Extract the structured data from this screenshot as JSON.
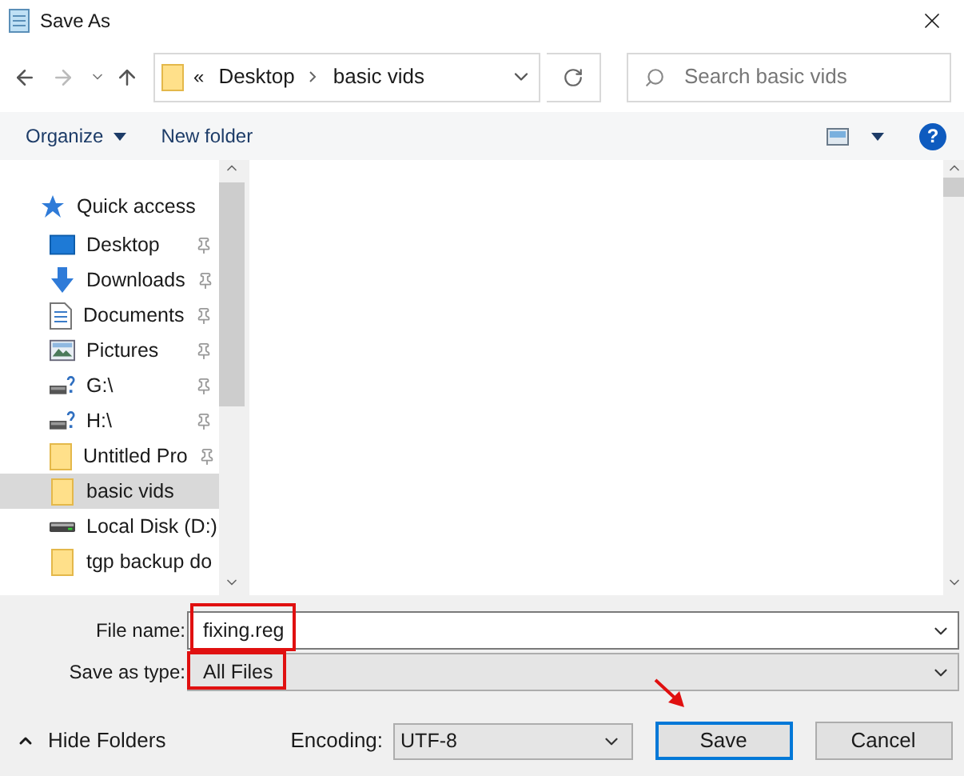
{
  "window": {
    "title": "Save As"
  },
  "address": {
    "overflow": "«",
    "crumbs": [
      "Desktop",
      "basic vids"
    ]
  },
  "search": {
    "placeholder": "Search basic vids"
  },
  "toolbar": {
    "organize": "Organize",
    "new_folder": "New folder",
    "help": "?"
  },
  "sidebar": {
    "items": [
      {
        "label": "Quick access",
        "kind": "star",
        "pinned": false,
        "selected": false
      },
      {
        "label": "Desktop",
        "kind": "desktop",
        "pinned": true,
        "selected": false
      },
      {
        "label": "Downloads",
        "kind": "download",
        "pinned": true,
        "selected": false
      },
      {
        "label": "Documents",
        "kind": "document",
        "pinned": true,
        "selected": false
      },
      {
        "label": "Pictures",
        "kind": "pictures",
        "pinned": true,
        "selected": false
      },
      {
        "label": "G:\\",
        "kind": "drive",
        "pinned": true,
        "selected": false
      },
      {
        "label": "H:\\",
        "kind": "drive",
        "pinned": true,
        "selected": false
      },
      {
        "label": "Untitled Pro",
        "kind": "folder",
        "pinned": true,
        "selected": false
      },
      {
        "label": "basic vids",
        "kind": "folder",
        "pinned": false,
        "selected": true
      },
      {
        "label": "Local Disk (D:)",
        "kind": "disk",
        "pinned": false,
        "selected": false
      },
      {
        "label": "tgp backup do",
        "kind": "folder",
        "pinned": false,
        "selected": false
      }
    ]
  },
  "form": {
    "file_name_label": "File name:",
    "file_name": "fixing.reg",
    "type_label": "Save as type:",
    "type": "All Files",
    "highlighted": true
  },
  "footer": {
    "hide_folders": "Hide Folders",
    "encoding_label": "Encoding:",
    "encoding": "UTF-8",
    "save": "Save",
    "cancel": "Cancel",
    "save_focused": true
  }
}
